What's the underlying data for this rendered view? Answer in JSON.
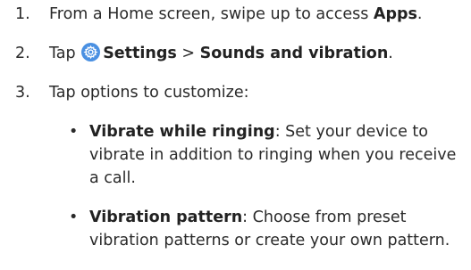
{
  "steps": [
    {
      "number": "1.",
      "text_before": "From a Home screen, swipe up to access ",
      "bold": "Apps",
      "text_after": "."
    },
    {
      "number": "2.",
      "text_before": "Tap ",
      "bold_settings": "Settings",
      "separator": " > ",
      "bold_sounds": "Sounds and vibration",
      "text_after": ".",
      "icon": "settings-gear-icon"
    },
    {
      "number": "3.",
      "text": "Tap options to customize:"
    }
  ],
  "options": [
    {
      "bullet": "•",
      "title": "Vibrate while ringing",
      "lines": [
        ": Set your device to",
        "vibrate in addition to ringing when you receive",
        "a call."
      ]
    },
    {
      "bullet": "•",
      "title": "Vibration pattern",
      "lines": [
        ": Choose from preset",
        "vibration patterns or create your own pattern."
      ]
    }
  ],
  "colors": {
    "text": "#2a2a2a",
    "icon_bg": "#4a90e2"
  }
}
